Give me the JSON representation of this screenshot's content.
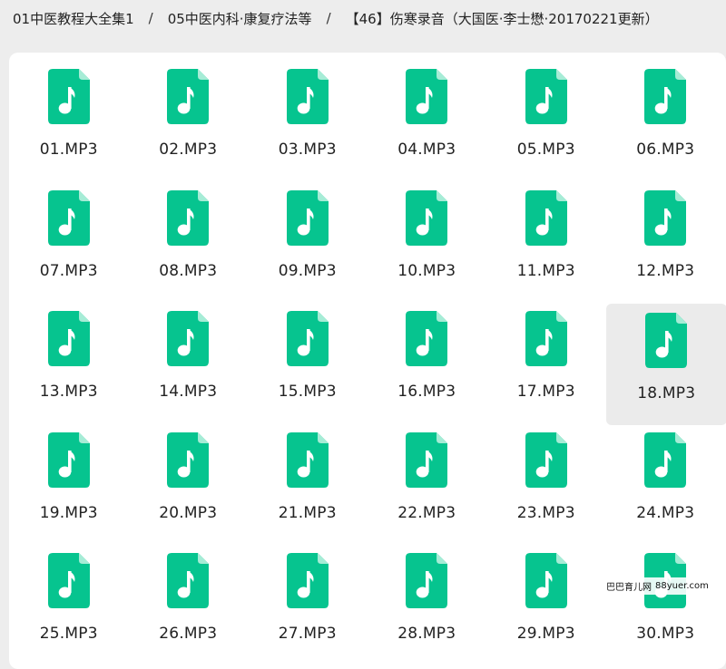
{
  "breadcrumb": {
    "items": [
      "01中医教程大全集1",
      "05中医内科·康复疗法等",
      "【46】伤寒录音（大国医·李士懋·20170221更新）"
    ],
    "separator": "/"
  },
  "files": [
    {
      "name": "01.MP3"
    },
    {
      "name": "02.MP3"
    },
    {
      "name": "03.MP3"
    },
    {
      "name": "04.MP3"
    },
    {
      "name": "05.MP3"
    },
    {
      "name": "06.MP3"
    },
    {
      "name": "07.MP3"
    },
    {
      "name": "08.MP3"
    },
    {
      "name": "09.MP3"
    },
    {
      "name": "10.MP3"
    },
    {
      "name": "11.MP3"
    },
    {
      "name": "12.MP3"
    },
    {
      "name": "13.MP3"
    },
    {
      "name": "14.MP3"
    },
    {
      "name": "15.MP3"
    },
    {
      "name": "16.MP3"
    },
    {
      "name": "17.MP3"
    },
    {
      "name": "18.MP3",
      "selected": true
    },
    {
      "name": "19.MP3"
    },
    {
      "name": "20.MP3"
    },
    {
      "name": "21.MP3"
    },
    {
      "name": "22.MP3"
    },
    {
      "name": "23.MP3"
    },
    {
      "name": "24.MP3"
    },
    {
      "name": "25.MP3"
    },
    {
      "name": "26.MP3"
    },
    {
      "name": "27.MP3"
    },
    {
      "name": "28.MP3"
    },
    {
      "name": "29.MP3"
    },
    {
      "name": "30.MP3"
    }
  ],
  "file_icon": {
    "name": "music-file-icon",
    "color": "#06c48f",
    "fold_color": "#a6ecd6",
    "glyph_color": "#ffffff"
  },
  "watermark": {
    "text": "巴巴育儿网",
    "url": "88yuer.com"
  }
}
